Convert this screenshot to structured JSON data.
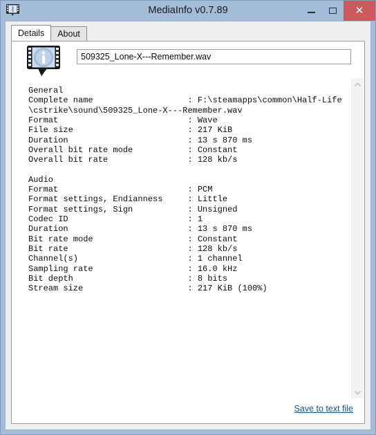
{
  "window": {
    "title": "MediaInfo v0.7.89",
    "app_icon": "film-strip-icon",
    "controls": {
      "minimize": "–",
      "maximize": "□",
      "close": "✕"
    },
    "colors": {
      "titlebar": "#a3bcd8",
      "close_button": "#cb5b5b",
      "dialog_background": "#efefef",
      "panel_background": "#ffffff",
      "link": "#1a4f96"
    }
  },
  "tabs": [
    {
      "label": "Details",
      "active": true
    },
    {
      "label": "About",
      "active": false
    }
  ],
  "header": {
    "logo_icon": "mediainfo-logo-icon",
    "filename_value": "509325_Lone-X---Remember.wav",
    "filename_placeholder": ""
  },
  "details": {
    "text": "General\nComplete name                   : F:\\steamapps\\common\\Half-Life\n\\cstrike\\sound\\509325_Lone-X---Remember.wav\nFormat                          : Wave\nFile size                       : 217 KiB\nDuration                        : 13 s 870 ms\nOverall bit rate mode           : Constant\nOverall bit rate                : 128 kb/s\n\nAudio\nFormat                          : PCM\nFormat settings, Endianness     : Little\nFormat settings, Sign           : Unsigned\nCodec ID                        : 1\nDuration                        : 13 s 870 ms\nBit rate mode                   : Constant\nBit rate                        : 128 kb/s\nChannel(s)                      : 1 channel\nSampling rate                   : 16.0 kHz\nBit depth                       : 8 bits\nStream size                     : 217 KiB (100%)",
    "sections": [
      {
        "name": "General",
        "fields": [
          {
            "label": "Complete name",
            "value": "F:\\steamapps\\common\\Half-Life\\cstrike\\sound\\509325_Lone-X---Remember.wav"
          },
          {
            "label": "Format",
            "value": "Wave"
          },
          {
            "label": "File size",
            "value": "217 KiB"
          },
          {
            "label": "Duration",
            "value": "13 s 870 ms"
          },
          {
            "label": "Overall bit rate mode",
            "value": "Constant"
          },
          {
            "label": "Overall bit rate",
            "value": "128 kb/s"
          }
        ]
      },
      {
        "name": "Audio",
        "fields": [
          {
            "label": "Format",
            "value": "PCM"
          },
          {
            "label": "Format settings, Endianness",
            "value": "Little"
          },
          {
            "label": "Format settings, Sign",
            "value": "Unsigned"
          },
          {
            "label": "Codec ID",
            "value": "1"
          },
          {
            "label": "Duration",
            "value": "13 s 870 ms"
          },
          {
            "label": "Bit rate mode",
            "value": "Constant"
          },
          {
            "label": "Bit rate",
            "value": "128 kb/s"
          },
          {
            "label": "Channel(s)",
            "value": "1 channel"
          },
          {
            "label": "Sampling rate",
            "value": "16.0 kHz"
          },
          {
            "label": "Bit depth",
            "value": "8 bits"
          },
          {
            "label": "Stream size",
            "value": "217 KiB (100%)"
          }
        ]
      }
    ]
  },
  "scrollbar": {
    "up_arrow_icon": "chevron-up-icon",
    "down_arrow_icon": "chevron-down-icon"
  },
  "footer": {
    "save_link_label": "Save to text file"
  }
}
